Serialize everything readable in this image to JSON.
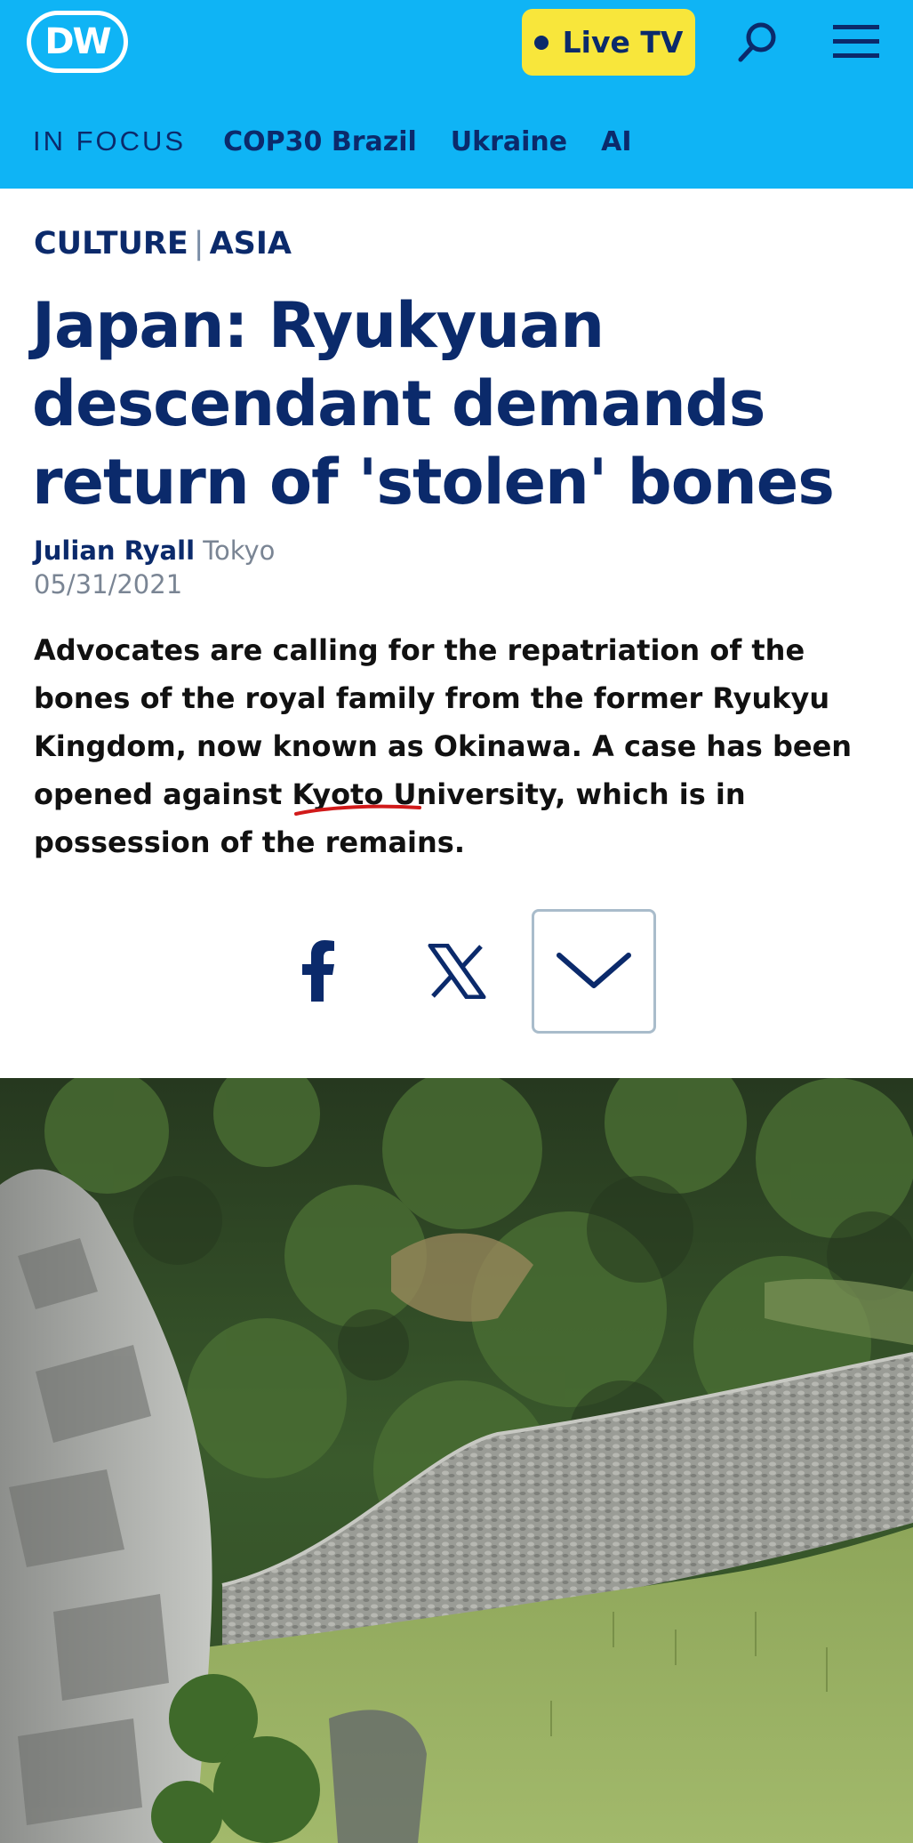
{
  "header": {
    "logo_text": "DW",
    "live_tv_label": "Live TV",
    "search_icon": "search-icon",
    "menu_icon": "hamburger-menu-icon",
    "background_color": "#0fb4f5",
    "accent_color": "#f8e63b",
    "brand_color": "#0b2a6b"
  },
  "nav": {
    "label": "IN FOCUS",
    "items": [
      {
        "label": "COP30 Brazil"
      },
      {
        "label": "Ukraine"
      },
      {
        "label": "AI"
      }
    ]
  },
  "article": {
    "category": "CULTURE",
    "region": "ASIA",
    "separator": "|",
    "headline": "Japan: Ryukyuan descendant demands return of 'stolen' bones",
    "author": "Julian Ryall",
    "location": "Tokyo",
    "date": "05/31/2021",
    "teaser": "Advocates are calling for the repatriation of the bones of the royal family from the former Ryukyu Kingdom, now known as Okinawa. A case has been opened against Kyoto University, which is in possession of the remains."
  },
  "share": {
    "facebook_icon": "facebook-icon",
    "x_icon": "x-icon",
    "more_icon": "chevron-down-icon"
  },
  "hero_image": {
    "subject": "stone castle wall on a hillside with dense forest"
  }
}
